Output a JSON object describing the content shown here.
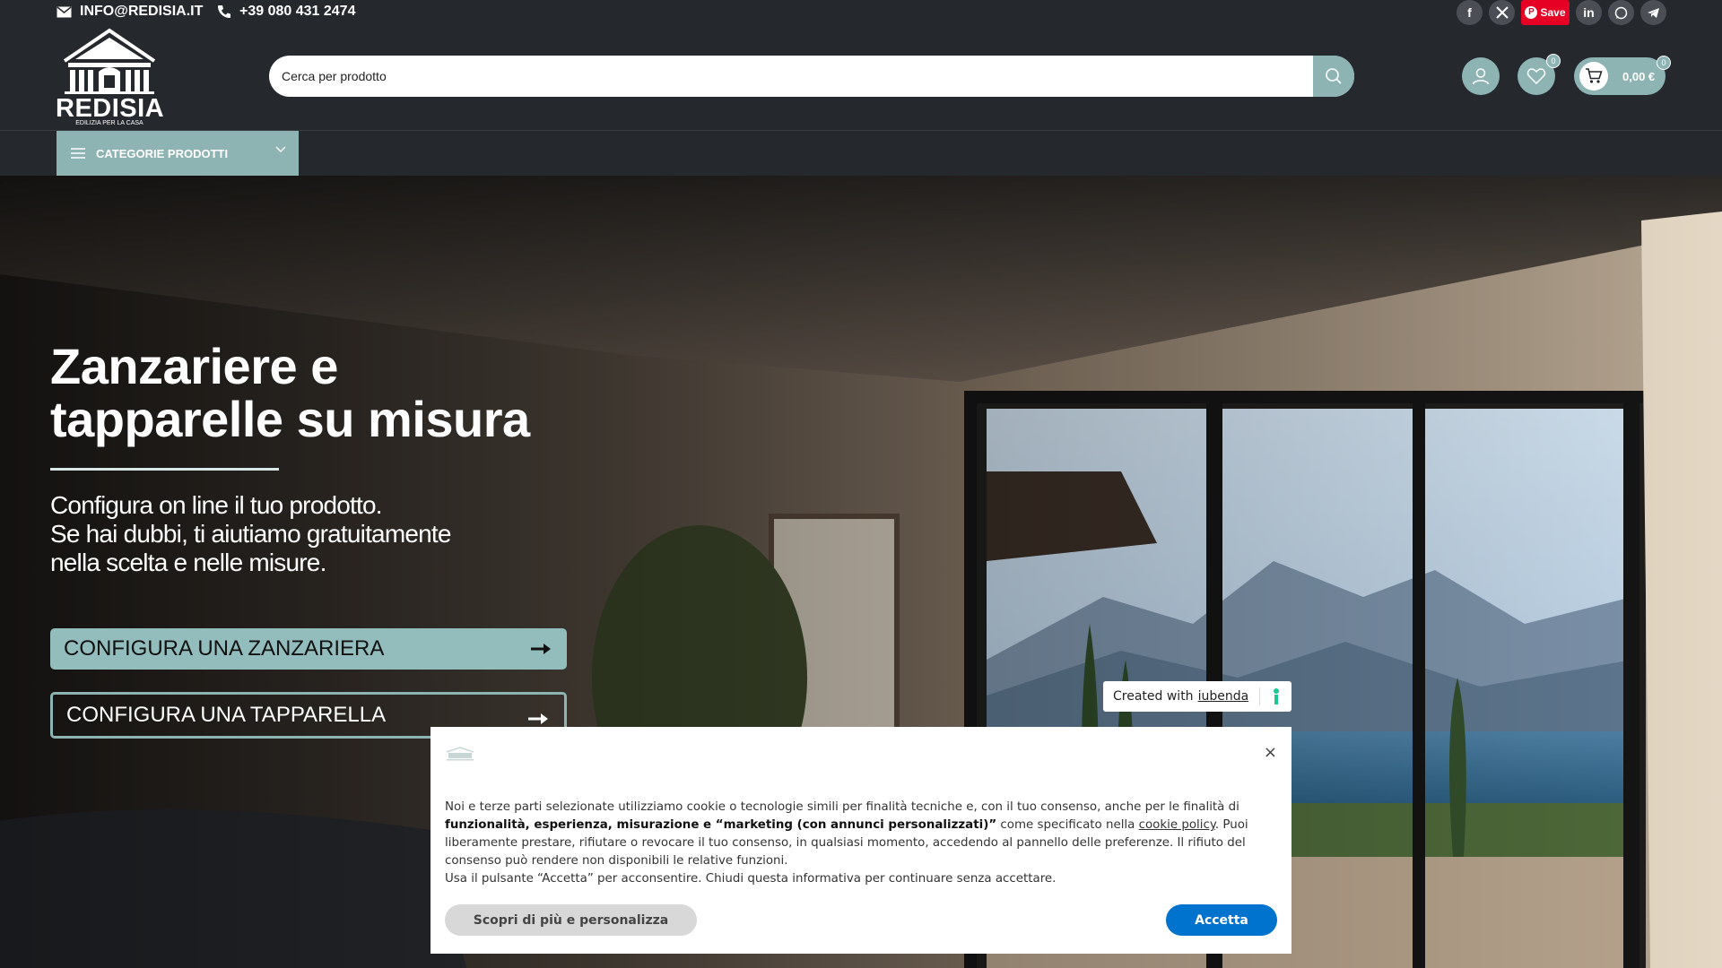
{
  "header": {
    "email": "INFO@REDISIA.IT",
    "phone": "+39 080 431 2474",
    "social": {
      "facebook": "f",
      "linkedin": "in",
      "pinterest_save": "Save"
    },
    "logo": {
      "name": "REDISIA",
      "tagline": "EDILIZIA PER LA CASA"
    },
    "search": {
      "placeholder": "Cerca per prodotto"
    },
    "wishlist_count": "0",
    "cart": {
      "total": "0,00 €",
      "count": "0"
    },
    "categories_label": "CATEGORIE PRODOTTI"
  },
  "hero": {
    "title_line1": "Zanzariere e",
    "title_line2": "tapparelle su misura",
    "subtitle_line1": "Configura on line il tuo prodotto.",
    "subtitle_line2": "Se hai dubbi, ti aiutiamo gratuitamente",
    "subtitle_line3": "nella scelta e nelle misure.",
    "cta_zanzariera": "CONFIGURA UNA ZANZARIERA",
    "cta_tapparella": "CONFIGURA UNA TAPPARELLA"
  },
  "iubenda_badge": {
    "prefix": "Created with",
    "link": "iubenda"
  },
  "cookie_banner": {
    "text_1": "Noi e terze parti selezionate utilizziamo cookie o tecnologie simili per finalità tecniche e, con il tuo consenso, anche per le finalità di",
    "text_bold": "funzionalità, esperienza, misurazione e “marketing (con annunci personalizzati)”",
    "text_2": " come specificato nella ",
    "policy_link": "cookie policy",
    "text_3": ". Puoi liberamente prestare, rifiutare o revocare il tuo consenso, in qualsiasi momento, accedendo al pannello delle preferenze. Il rifiuto del consenso può rendere non disponibili le relative funzioni.",
    "text_4": "Usa il pulsante “Accetta” per acconsentire. Chiudi questa informativa per continuare senza accettare.",
    "close": "×",
    "more_button": "Scopri di più e personalizza",
    "accept_button": "Accetta"
  },
  "colors": {
    "header_bg": "#25282d",
    "accent": "#8db3b3",
    "accept_blue": "#0073ce",
    "pinterest": "#e60023"
  }
}
